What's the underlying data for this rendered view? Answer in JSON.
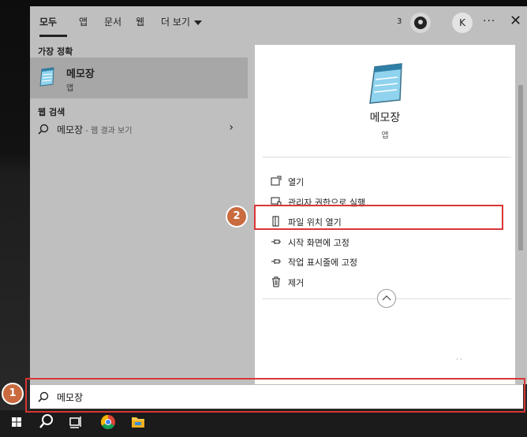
{
  "tabs": [
    {
      "label": "모두",
      "active": true
    },
    {
      "label": "앱"
    },
    {
      "label": "문서"
    },
    {
      "label": "웹"
    },
    {
      "label": "더 보기"
    }
  ],
  "header": {
    "badge_count": "3",
    "avatar_letter": "K",
    "more_label": "···",
    "close_label": "✕"
  },
  "best_match": {
    "section": "가장 정확",
    "title": "메모장",
    "subtitle": "앱"
  },
  "web_search": {
    "section": "웹 검색",
    "query": "메모장",
    "suffix": " - 웹 결과 보기"
  },
  "detail": {
    "title": "메모장",
    "subtitle": "앱",
    "actions": [
      {
        "label": "열기",
        "icon": "open-icon"
      },
      {
        "label": "관리자 권한으로 실행",
        "icon": "admin-shield-icon"
      },
      {
        "label": "파일 위치 열기",
        "icon": "file-location-icon"
      },
      {
        "label": "시작 화면에 고정",
        "icon": "pin-icon"
      },
      {
        "label": "작업 표시줄에 고정",
        "icon": "pin-icon"
      },
      {
        "label": "제거",
        "icon": "trash-icon"
      }
    ]
  },
  "search": {
    "value": "메모장"
  },
  "annotations": {
    "step1": "1",
    "step2": "2",
    "color": "#d93636",
    "circle_color": "#c96a3f"
  },
  "taskbar": [
    "windows-start-icon",
    "search-icon",
    "task-view-icon",
    "chrome-icon",
    "file-explorer-icon"
  ]
}
